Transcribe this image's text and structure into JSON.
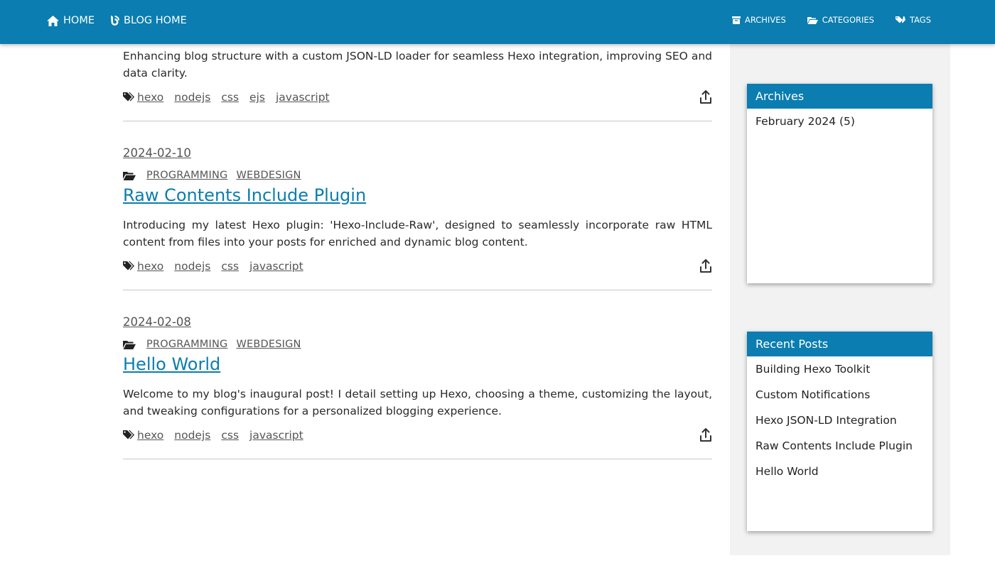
{
  "navbar": {
    "left": [
      {
        "label": "Home",
        "icon": "home-icon"
      },
      {
        "label": "Blog Home",
        "icon": "blog-icon"
      }
    ],
    "right": [
      {
        "label": "Archives",
        "icon": "archive-box-icon"
      },
      {
        "label": "Categories",
        "icon": "folder-icon"
      },
      {
        "label": "Tags",
        "icon": "tags-icon"
      }
    ],
    "color": "#0b7db0"
  },
  "posts": [
    {
      "excerpt": "Enhancing blog structure with a custom JSON-LD loader for seamless Hexo integration, improving SEO and data clarity.",
      "tags": [
        "hexo",
        "nodejs",
        "css",
        "ejs",
        "javascript"
      ]
    },
    {
      "date": "2024-02-10",
      "categories": [
        "Programming",
        "WebDesign"
      ],
      "title": "Raw Contents Include Plugin",
      "excerpt": "Introducing my latest Hexo plugin: 'Hexo-Include-Raw', designed to seamlessly incorporate raw HTML content from files into your posts for enriched and dynamic blog content.",
      "tags": [
        "hexo",
        "nodejs",
        "css",
        "javascript"
      ]
    },
    {
      "date": "2024-02-08",
      "categories": [
        "Programming",
        "WebDesign"
      ],
      "title": "Hello World",
      "excerpt": "Welcome to my blog's inaugural post! I detail setting up Hexo, choosing a theme, customizing the layout, and tweaking configurations for a personalized blogging experience.",
      "tags": [
        "hexo",
        "nodejs",
        "css",
        "javascript"
      ]
    }
  ],
  "sidebar": {
    "archives": {
      "title": "Archives",
      "items": [
        "February 2024 (5)"
      ]
    },
    "recent": {
      "title": "Recent Posts",
      "items": [
        "Building Hexo Toolkit",
        "Custom Notifications",
        "Hexo JSON-LD Integration",
        "Raw Contents Include Plugin",
        "Hello World"
      ]
    }
  }
}
